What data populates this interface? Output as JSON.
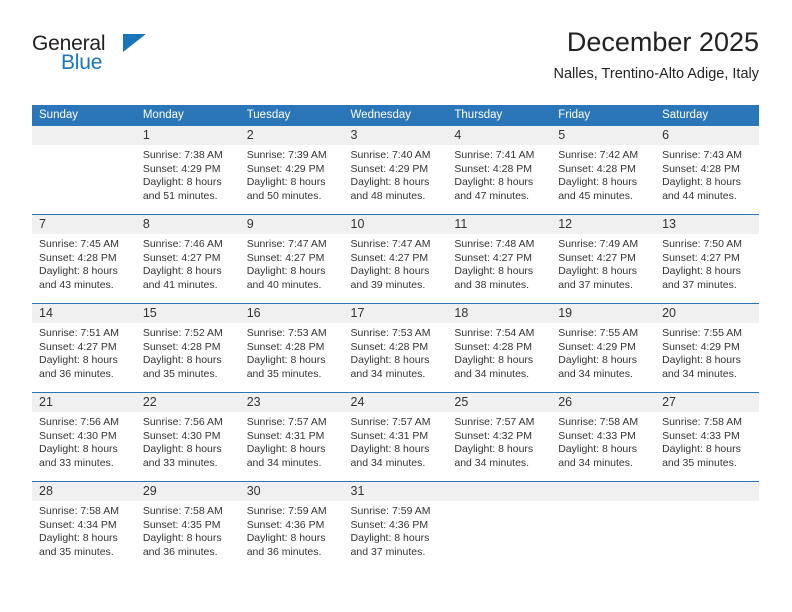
{
  "brand": {
    "name_top": "General",
    "name_bottom": "Blue",
    "accent_color": "#1b75bb"
  },
  "header": {
    "title": "December 2025",
    "subtitle": "Nalles, Trentino-Alto Adige, Italy"
  },
  "theme": {
    "header_bg": "#2b76b9",
    "daynum_bg": "#f0f0f0",
    "text": "#333333"
  },
  "weekday_headers": [
    "Sunday",
    "Monday",
    "Tuesday",
    "Wednesday",
    "Thursday",
    "Friday",
    "Saturday"
  ],
  "weeks": [
    [
      {
        "day": "",
        "sunrise": "",
        "sunset": "",
        "daylight1": "",
        "daylight2": ""
      },
      {
        "day": "1",
        "sunrise": "Sunrise: 7:38 AM",
        "sunset": "Sunset: 4:29 PM",
        "daylight1": "Daylight: 8 hours",
        "daylight2": "and 51 minutes."
      },
      {
        "day": "2",
        "sunrise": "Sunrise: 7:39 AM",
        "sunset": "Sunset: 4:29 PM",
        "daylight1": "Daylight: 8 hours",
        "daylight2": "and 50 minutes."
      },
      {
        "day": "3",
        "sunrise": "Sunrise: 7:40 AM",
        "sunset": "Sunset: 4:29 PM",
        "daylight1": "Daylight: 8 hours",
        "daylight2": "and 48 minutes."
      },
      {
        "day": "4",
        "sunrise": "Sunrise: 7:41 AM",
        "sunset": "Sunset: 4:28 PM",
        "daylight1": "Daylight: 8 hours",
        "daylight2": "and 47 minutes."
      },
      {
        "day": "5",
        "sunrise": "Sunrise: 7:42 AM",
        "sunset": "Sunset: 4:28 PM",
        "daylight1": "Daylight: 8 hours",
        "daylight2": "and 45 minutes."
      },
      {
        "day": "6",
        "sunrise": "Sunrise: 7:43 AM",
        "sunset": "Sunset: 4:28 PM",
        "daylight1": "Daylight: 8 hours",
        "daylight2": "and 44 minutes."
      }
    ],
    [
      {
        "day": "7",
        "sunrise": "Sunrise: 7:45 AM",
        "sunset": "Sunset: 4:28 PM",
        "daylight1": "Daylight: 8 hours",
        "daylight2": "and 43 minutes."
      },
      {
        "day": "8",
        "sunrise": "Sunrise: 7:46 AM",
        "sunset": "Sunset: 4:27 PM",
        "daylight1": "Daylight: 8 hours",
        "daylight2": "and 41 minutes."
      },
      {
        "day": "9",
        "sunrise": "Sunrise: 7:47 AM",
        "sunset": "Sunset: 4:27 PM",
        "daylight1": "Daylight: 8 hours",
        "daylight2": "and 40 minutes."
      },
      {
        "day": "10",
        "sunrise": "Sunrise: 7:47 AM",
        "sunset": "Sunset: 4:27 PM",
        "daylight1": "Daylight: 8 hours",
        "daylight2": "and 39 minutes."
      },
      {
        "day": "11",
        "sunrise": "Sunrise: 7:48 AM",
        "sunset": "Sunset: 4:27 PM",
        "daylight1": "Daylight: 8 hours",
        "daylight2": "and 38 minutes."
      },
      {
        "day": "12",
        "sunrise": "Sunrise: 7:49 AM",
        "sunset": "Sunset: 4:27 PM",
        "daylight1": "Daylight: 8 hours",
        "daylight2": "and 37 minutes."
      },
      {
        "day": "13",
        "sunrise": "Sunrise: 7:50 AM",
        "sunset": "Sunset: 4:27 PM",
        "daylight1": "Daylight: 8 hours",
        "daylight2": "and 37 minutes."
      }
    ],
    [
      {
        "day": "14",
        "sunrise": "Sunrise: 7:51 AM",
        "sunset": "Sunset: 4:27 PM",
        "daylight1": "Daylight: 8 hours",
        "daylight2": "and 36 minutes."
      },
      {
        "day": "15",
        "sunrise": "Sunrise: 7:52 AM",
        "sunset": "Sunset: 4:28 PM",
        "daylight1": "Daylight: 8 hours",
        "daylight2": "and 35 minutes."
      },
      {
        "day": "16",
        "sunrise": "Sunrise: 7:53 AM",
        "sunset": "Sunset: 4:28 PM",
        "daylight1": "Daylight: 8 hours",
        "daylight2": "and 35 minutes."
      },
      {
        "day": "17",
        "sunrise": "Sunrise: 7:53 AM",
        "sunset": "Sunset: 4:28 PM",
        "daylight1": "Daylight: 8 hours",
        "daylight2": "and 34 minutes."
      },
      {
        "day": "18",
        "sunrise": "Sunrise: 7:54 AM",
        "sunset": "Sunset: 4:28 PM",
        "daylight1": "Daylight: 8 hours",
        "daylight2": "and 34 minutes."
      },
      {
        "day": "19",
        "sunrise": "Sunrise: 7:55 AM",
        "sunset": "Sunset: 4:29 PM",
        "daylight1": "Daylight: 8 hours",
        "daylight2": "and 34 minutes."
      },
      {
        "day": "20",
        "sunrise": "Sunrise: 7:55 AM",
        "sunset": "Sunset: 4:29 PM",
        "daylight1": "Daylight: 8 hours",
        "daylight2": "and 34 minutes."
      }
    ],
    [
      {
        "day": "21",
        "sunrise": "Sunrise: 7:56 AM",
        "sunset": "Sunset: 4:30 PM",
        "daylight1": "Daylight: 8 hours",
        "daylight2": "and 33 minutes."
      },
      {
        "day": "22",
        "sunrise": "Sunrise: 7:56 AM",
        "sunset": "Sunset: 4:30 PM",
        "daylight1": "Daylight: 8 hours",
        "daylight2": "and 33 minutes."
      },
      {
        "day": "23",
        "sunrise": "Sunrise: 7:57 AM",
        "sunset": "Sunset: 4:31 PM",
        "daylight1": "Daylight: 8 hours",
        "daylight2": "and 34 minutes."
      },
      {
        "day": "24",
        "sunrise": "Sunrise: 7:57 AM",
        "sunset": "Sunset: 4:31 PM",
        "daylight1": "Daylight: 8 hours",
        "daylight2": "and 34 minutes."
      },
      {
        "day": "25",
        "sunrise": "Sunrise: 7:57 AM",
        "sunset": "Sunset: 4:32 PM",
        "daylight1": "Daylight: 8 hours",
        "daylight2": "and 34 minutes."
      },
      {
        "day": "26",
        "sunrise": "Sunrise: 7:58 AM",
        "sunset": "Sunset: 4:33 PM",
        "daylight1": "Daylight: 8 hours",
        "daylight2": "and 34 minutes."
      },
      {
        "day": "27",
        "sunrise": "Sunrise: 7:58 AM",
        "sunset": "Sunset: 4:33 PM",
        "daylight1": "Daylight: 8 hours",
        "daylight2": "and 35 minutes."
      }
    ],
    [
      {
        "day": "28",
        "sunrise": "Sunrise: 7:58 AM",
        "sunset": "Sunset: 4:34 PM",
        "daylight1": "Daylight: 8 hours",
        "daylight2": "and 35 minutes."
      },
      {
        "day": "29",
        "sunrise": "Sunrise: 7:58 AM",
        "sunset": "Sunset: 4:35 PM",
        "daylight1": "Daylight: 8 hours",
        "daylight2": "and 36 minutes."
      },
      {
        "day": "30",
        "sunrise": "Sunrise: 7:59 AM",
        "sunset": "Sunset: 4:36 PM",
        "daylight1": "Daylight: 8 hours",
        "daylight2": "and 36 minutes."
      },
      {
        "day": "31",
        "sunrise": "Sunrise: 7:59 AM",
        "sunset": "Sunset: 4:36 PM",
        "daylight1": "Daylight: 8 hours",
        "daylight2": "and 37 minutes."
      },
      {
        "day": "",
        "sunrise": "",
        "sunset": "",
        "daylight1": "",
        "daylight2": ""
      },
      {
        "day": "",
        "sunrise": "",
        "sunset": "",
        "daylight1": "",
        "daylight2": ""
      },
      {
        "day": "",
        "sunrise": "",
        "sunset": "",
        "daylight1": "",
        "daylight2": ""
      }
    ]
  ]
}
